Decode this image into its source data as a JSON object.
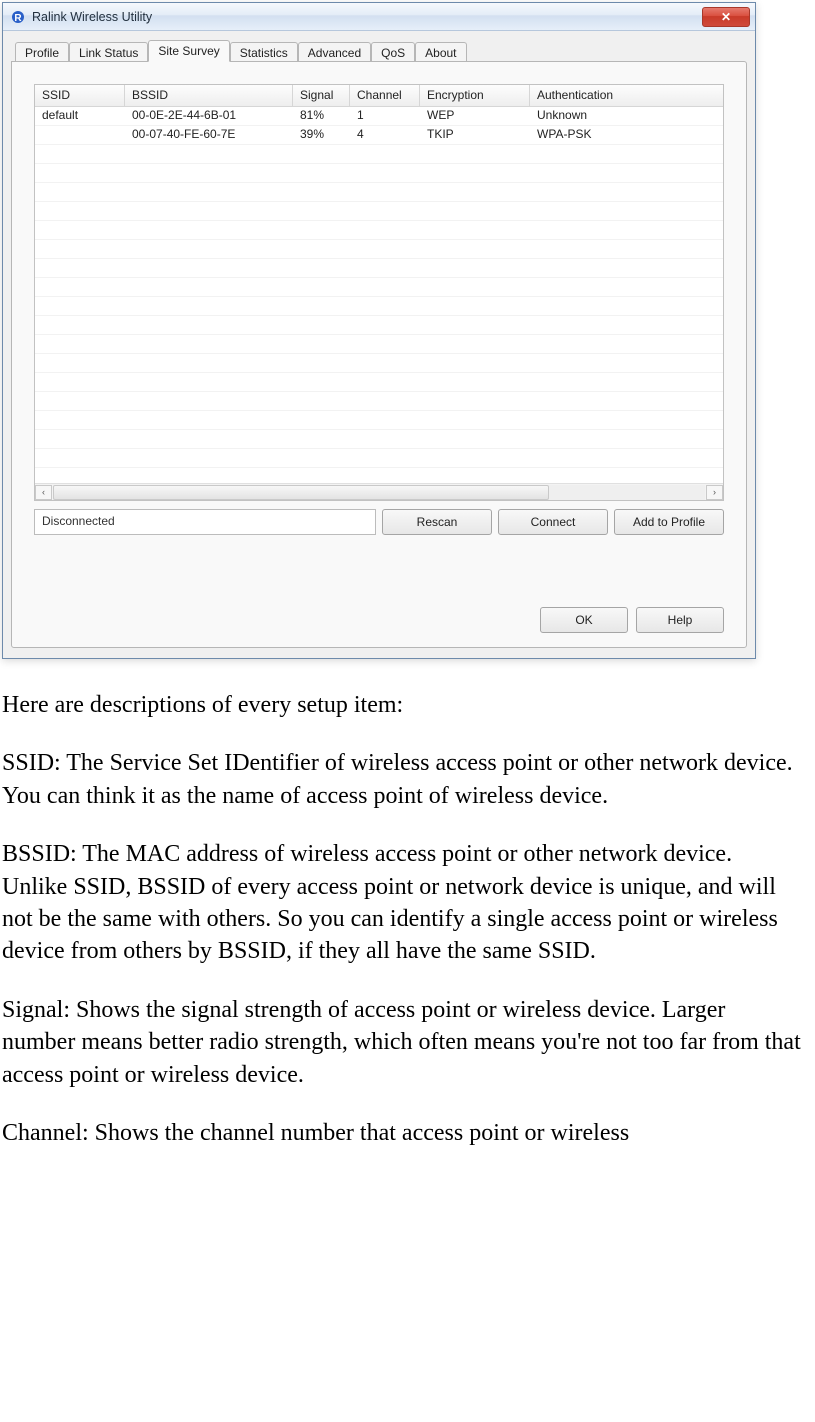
{
  "window": {
    "title": "Ralink Wireless Utility",
    "close_glyph": "✕"
  },
  "tabs": {
    "items": [
      "Profile",
      "Link Status",
      "Site Survey",
      "Statistics",
      "Advanced",
      "QoS",
      "About"
    ],
    "active_index": 2
  },
  "grid": {
    "headers": [
      "SSID",
      "BSSID",
      "Signal",
      "Channel",
      "Encryption",
      "Authentication"
    ],
    "rows": [
      {
        "ssid": "default",
        "bssid": "00-0E-2E-44-6B-01",
        "signal": "81%",
        "channel": "1",
        "encryption": "WEP",
        "auth": "Unknown"
      },
      {
        "ssid": "",
        "bssid": "00-07-40-FE-60-7E",
        "signal": "39%",
        "channel": "4",
        "encryption": "TKIP",
        "auth": "WPA-PSK"
      }
    ],
    "scroll_left": "‹",
    "scroll_right": "›"
  },
  "status": {
    "text": "Disconnected"
  },
  "buttons": {
    "rescan": "Rescan",
    "connect": "Connect",
    "add_profile": "Add to Profile",
    "ok": "OK",
    "help": "Help"
  },
  "doc": {
    "p1": "Here are descriptions of every setup item:",
    "p2": "SSID: The Service Set IDentifier of wireless access point or other network device. You can think it as the name of access point of wireless device.",
    "p3": "BSSID: The MAC address of wireless access point or other network device. Unlike SSID, BSSID of every access point or network device is unique, and will not be the same with others. So you can identify a single access point or wireless device from others by BSSID, if they all have the same SSID.",
    "p4": "Signal: Shows the signal strength of access point or wireless device. Larger number means better radio strength, which often means you're not too far from that access point or wireless device.",
    "p5": "Channel: Shows the channel number that access point or wireless"
  }
}
